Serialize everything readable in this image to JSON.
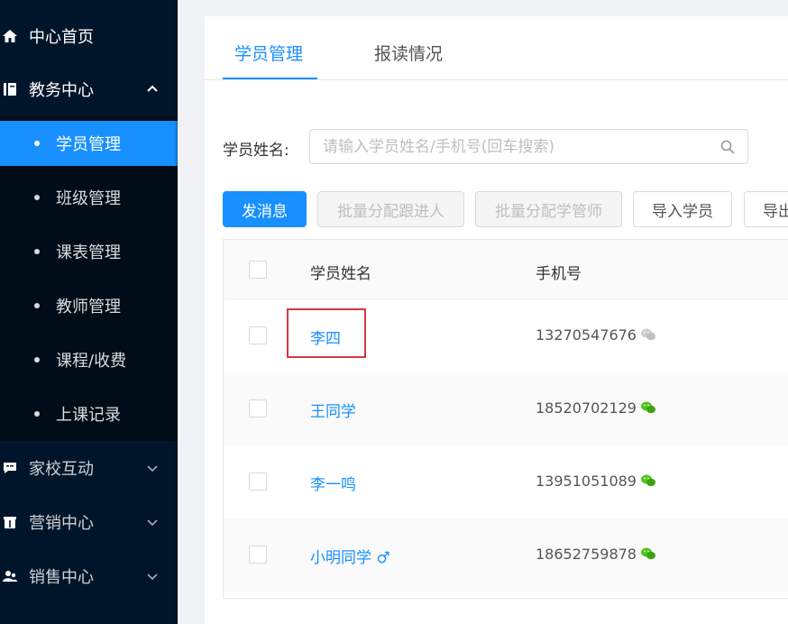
{
  "sidebar": {
    "items": [
      {
        "label": "中心首页",
        "icon": "home-icon"
      },
      {
        "label": "教务中心",
        "icon": "book-icon",
        "expanded": true
      },
      {
        "label": "家校互动",
        "icon": "chat-icon"
      },
      {
        "label": "营销中心",
        "icon": "gift-icon"
      },
      {
        "label": "销售中心",
        "icon": "users-icon"
      }
    ],
    "sub_items": [
      {
        "label": "学员管理",
        "active": true
      },
      {
        "label": "班级管理"
      },
      {
        "label": "课表管理"
      },
      {
        "label": "教师管理"
      },
      {
        "label": "课程/收费"
      },
      {
        "label": "上课记录"
      }
    ]
  },
  "tabs": [
    {
      "label": "学员管理",
      "active": true
    },
    {
      "label": "报读情况"
    }
  ],
  "search": {
    "label": "学员姓名:",
    "placeholder": "请输入学员姓名/手机号(回车搜索)"
  },
  "toolbar": {
    "send_label": "发消息",
    "assign_follower_label": "批量分配跟进人",
    "assign_manager_label": "批量分配学管师",
    "import_label": "导入学员",
    "export_label": "导出"
  },
  "table": {
    "columns": [
      "学员姓名",
      "手机号"
    ],
    "rows": [
      {
        "name": "李四",
        "phone": "13270547676",
        "wechat": false
      },
      {
        "name": "王同学",
        "phone": "18520702129",
        "wechat": true
      },
      {
        "name": "李一鸣",
        "phone": "13951051089",
        "wechat": true
      },
      {
        "name": "小明同学 ♂",
        "phone": "18652759878",
        "wechat": true
      }
    ]
  },
  "colors": {
    "sidebar_bg": "#001529",
    "accent": "#1890ff",
    "wechat_green": "#52c41a",
    "highlight_red": "#d9363e"
  }
}
